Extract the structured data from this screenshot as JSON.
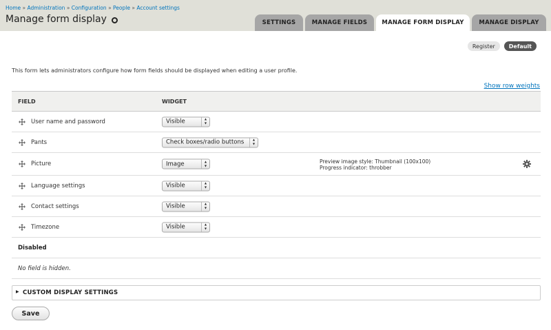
{
  "breadcrumb": [
    "Home",
    "Administration",
    "Configuration",
    "People",
    "Account settings"
  ],
  "breadcrumb_separator": "»",
  "page_title": "Manage form display",
  "tabs": [
    {
      "label": "SETTINGS",
      "active": false
    },
    {
      "label": "MANAGE FIELDS",
      "active": false
    },
    {
      "label": "MANAGE FORM DISPLAY",
      "active": true
    },
    {
      "label": "MANAGE DISPLAY",
      "active": false
    }
  ],
  "form_modes": [
    {
      "label": "Register",
      "active": false
    },
    {
      "label": "Default",
      "active": true
    }
  ],
  "description": "This form lets administrators configure how form fields should be displayed when editing a user profile.",
  "show_row_weights": "Show row weights",
  "table": {
    "headers": {
      "field": "FIELD",
      "widget": "WIDGET"
    },
    "rows": [
      {
        "field": "User name and password",
        "widget": "Visible",
        "summary": [],
        "icon": "drag-handle-icon"
      },
      {
        "field": "Pants",
        "widget": "Check boxes/radio buttons",
        "summary": [],
        "icon": "drag-handle-icon"
      },
      {
        "field": "Picture",
        "widget": "Image",
        "summary": [
          "Preview image style: Thumbnail (100x100)",
          "Progress indicator: throbber"
        ],
        "icon": "drag-handle-icon",
        "settings_icon": "gear-icon"
      },
      {
        "field": "Language settings",
        "widget": "Visible",
        "summary": [],
        "icon": "drag-handle-icon"
      },
      {
        "field": "Contact settings",
        "widget": "Visible",
        "summary": [],
        "icon": "drag-handle-icon"
      },
      {
        "field": "Timezone",
        "widget": "Visible",
        "summary": [],
        "icon": "drag-handle-icon"
      }
    ],
    "disabled_region": {
      "title": "Disabled",
      "empty_text": "No field is hidden."
    }
  },
  "custom_display": {
    "label": "CUSTOM DISPLAY SETTINGS",
    "toggle_icon": "triangle-right-icon"
  },
  "save_label": "Save",
  "colors": {
    "header_bg": "#e0e0d8",
    "link": "#0074bd",
    "tab_inactive": "#a6a6a6",
    "pill_active": "#555555"
  }
}
